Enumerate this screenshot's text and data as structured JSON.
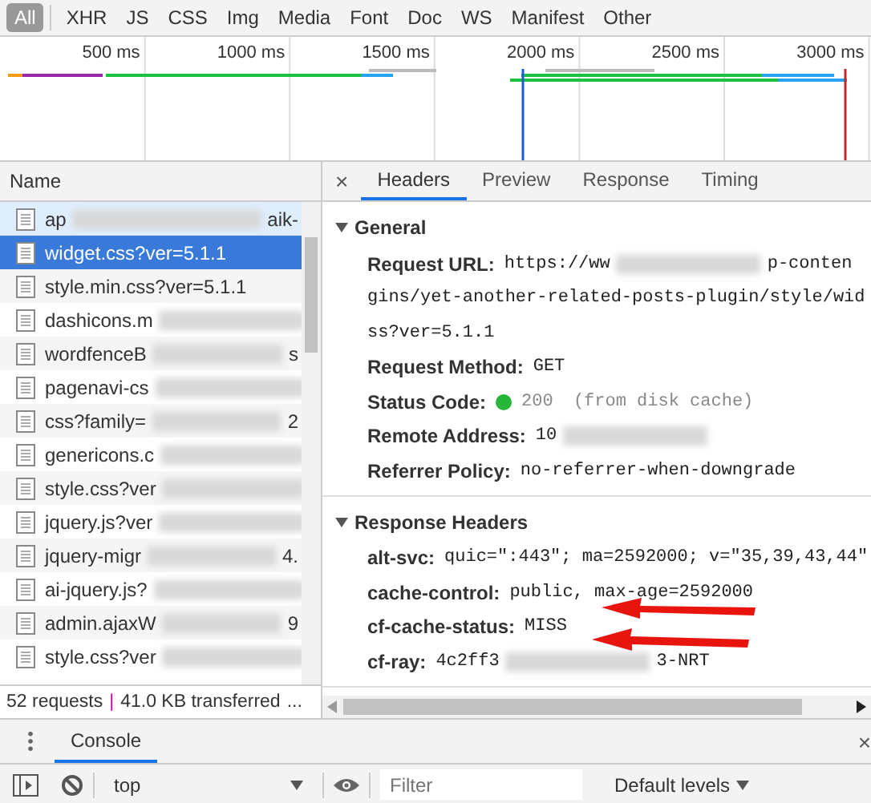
{
  "filter_bar": {
    "types": [
      {
        "label": "All",
        "selected": true
      },
      {
        "label": "XHR",
        "selected": false
      },
      {
        "label": "JS",
        "selected": false
      },
      {
        "label": "CSS",
        "selected": false
      },
      {
        "label": "Img",
        "selected": false
      },
      {
        "label": "Media",
        "selected": false
      },
      {
        "label": "Font",
        "selected": false
      },
      {
        "label": "Doc",
        "selected": false
      },
      {
        "label": "WS",
        "selected": false
      },
      {
        "label": "Manifest",
        "selected": false
      },
      {
        "label": "Other",
        "selected": false
      }
    ]
  },
  "overview": {
    "ticks": [
      "500 ms",
      "1000 ms",
      "1500 ms",
      "2000 ms",
      "2500 ms",
      "3000 ms"
    ]
  },
  "requests": {
    "column": "Name",
    "rows": [
      {
        "name": "ap",
        "suffix": "aik-",
        "blurred": true,
        "selected": false,
        "hovered": true
      },
      {
        "name": "widget.css?ver=5.1.1",
        "blurred": false,
        "selected": true,
        "hovered": false
      },
      {
        "name": "style.min.css?ver=5.1.1",
        "blurred": false,
        "selected": false,
        "hovered": false
      },
      {
        "name": "dashicons.m",
        "blurred": true,
        "selected": false,
        "hovered": false
      },
      {
        "name": "wordfenceB",
        "suffix": "s",
        "blurred": true,
        "selected": false,
        "hovered": false
      },
      {
        "name": "pagenavi-cs",
        "blurred": true,
        "selected": false,
        "hovered": false
      },
      {
        "name": "css?family=",
        "suffix": "2",
        "blurred": true,
        "selected": false,
        "hovered": false
      },
      {
        "name": "genericons.c",
        "blurred": true,
        "selected": false,
        "hovered": false
      },
      {
        "name": "style.css?ver",
        "blurred": true,
        "selected": false,
        "hovered": false
      },
      {
        "name": "jquery.js?ver",
        "blurred": true,
        "selected": false,
        "hovered": false
      },
      {
        "name": "jquery-migr",
        "suffix": "4.",
        "blurred": true,
        "selected": false,
        "hovered": false
      },
      {
        "name": "ai-jquery.js?",
        "blurred": true,
        "selected": false,
        "hovered": false
      },
      {
        "name": "admin.ajaxW",
        "suffix": "9",
        "blurred": true,
        "selected": false,
        "hovered": false
      },
      {
        "name": "style.css?ver",
        "blurred": true,
        "selected": false,
        "hovered": false
      }
    ],
    "summary": {
      "requests": "52 requests",
      "separator": "|",
      "transferred": "41.0 KB transferred",
      "more": "..."
    }
  },
  "details": {
    "close": "×",
    "tabs": [
      {
        "label": "Headers",
        "selected": true
      },
      {
        "label": "Preview",
        "selected": false
      },
      {
        "label": "Response",
        "selected": false
      },
      {
        "label": "Timing",
        "selected": false
      }
    ],
    "sections": [
      {
        "title": "General",
        "expanded": true,
        "rows": [
          {
            "kind": "field",
            "label": "Request URL:",
            "value": "https://ww",
            "blurred": true,
            "suffix": "p-conten"
          },
          {
            "kind": "continuation",
            "value": "gins/yet-another-related-posts-plugin/style/wid"
          },
          {
            "kind": "continuation",
            "value": "ss?ver=5.1.1"
          },
          {
            "kind": "field",
            "label": "Request Method:",
            "value": "GET",
            "blurred": false
          },
          {
            "kind": "status",
            "label": "Status Code:",
            "value": "200",
            "note": "(from disk cache)",
            "color": "#27b53a"
          },
          {
            "kind": "field",
            "label": "Remote Address:",
            "value": "10",
            "blurred": true
          },
          {
            "kind": "field",
            "label": "Referrer Policy:",
            "value": "no-referrer-when-downgrade",
            "blurred": false
          }
        ]
      },
      {
        "title": "Response Headers",
        "expanded": true,
        "rows": [
          {
            "kind": "field",
            "label": "alt-svc:",
            "value": "quic=\":443\"; ma=2592000; v=\"35,39,43,44\"",
            "blurred": false
          },
          {
            "kind": "field",
            "label": "cache-control:",
            "value": "public, max-age=2592000",
            "blurred": false
          },
          {
            "kind": "field",
            "label": "cf-cache-status:",
            "value": "MISS",
            "blurred": false
          },
          {
            "kind": "field",
            "label": "cf-ray:",
            "value": "4c2ff3",
            "blurred": true,
            "suffix": "3-NRT"
          }
        ]
      }
    ]
  },
  "drawer": {
    "close": "×",
    "tabs": [
      {
        "label": "Console",
        "selected": true
      }
    ],
    "toolbar": {
      "context": "top",
      "filter_placeholder": "Filter",
      "levels": "Default levels"
    }
  }
}
